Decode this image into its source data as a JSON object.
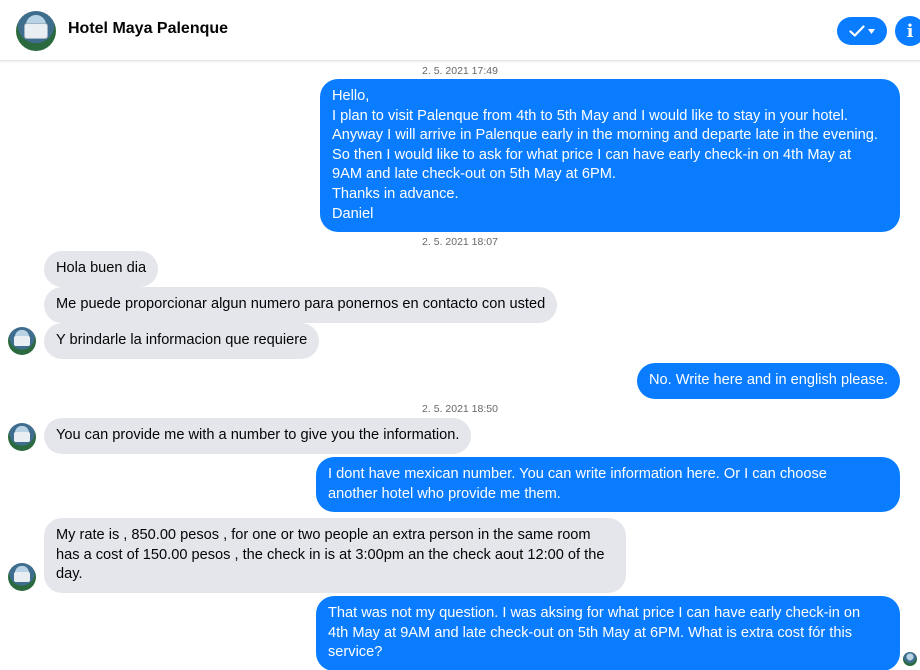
{
  "header": {
    "title": "Hotel Maya Palenque",
    "avatar_icon": "hotel-avatar",
    "check_icon": "check-icon",
    "info_icon": "info-icon",
    "accent_color": "#0a7cff"
  },
  "timestamps": [
    "2. 5. 2021 17:49",
    "2. 5. 2021 18:07",
    "2. 5. 2021 18:50"
  ],
  "messages": [
    {
      "from": "me",
      "lines": [
        "Hello,",
        "I plan to visit Palenque from 4th to 5th May and I would like to stay in your hotel.",
        "Anyway I will arrive in Palenque early in the morning and departe late in the evening.",
        "So then I would like to ask for what price I can have early check-in on 4th May at",
        "9AM and late check-out on 5th May at 6PM.",
        "Thanks in advance.",
        "Daniel"
      ]
    },
    {
      "from": "hotel",
      "lines": [
        "Hola buen dia"
      ]
    },
    {
      "from": "hotel",
      "lines": [
        "Me puede proporcionar algun numero para ponernos en contacto con usted"
      ]
    },
    {
      "from": "hotel",
      "lines": [
        "Y brindarle la informacion que requiere"
      ]
    },
    {
      "from": "me",
      "lines": [
        "No. Write here and in english please."
      ]
    },
    {
      "from": "hotel",
      "lines": [
        "You can provide me with a number to give you the information."
      ]
    },
    {
      "from": "me",
      "lines": [
        "I dont have mexican number. You can write information here. Or I can choose",
        "another hotel who provide me them."
      ]
    },
    {
      "from": "hotel",
      "lines": [
        "My rate is , 850.00 pesos , for one or two people an extra person in the same room",
        "has a cost of 150.00 pesos , the check in  is at 3:00pm  an the check aout 12:00 of the",
        "day."
      ]
    },
    {
      "from": "me",
      "lines": [
        "That was not my question. I was aksing for what price I can have early check-in on",
        "4th May at 9AM and late check-out on 5th May at 6PM. What is extra cost fór this",
        "service?"
      ]
    }
  ]
}
